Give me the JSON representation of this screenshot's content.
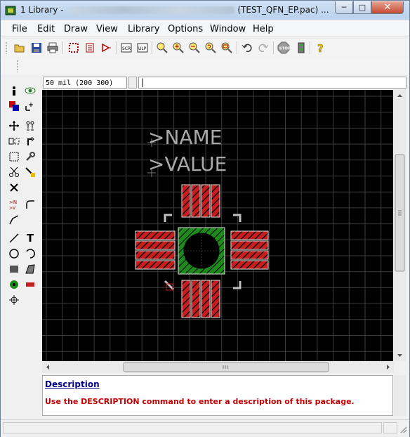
{
  "window": {
    "title_prefix": "1 Library - ",
    "title_suffix": "(TEST_QFN_EP.pac) ...",
    "controls": {
      "minimize": "─",
      "maximize": "□",
      "close": "✕"
    }
  },
  "menu": [
    "File",
    "Edit",
    "Draw",
    "View",
    "Library",
    "Options",
    "Window",
    "Help"
  ],
  "toolbar": {
    "icons": [
      "open-icon",
      "save-icon",
      "print-icon",
      "board-icon",
      "schematic-icon",
      "symbol-icon",
      "script-icon",
      "ulp-icon",
      "zoom-fit-icon",
      "zoom-in-icon",
      "zoom-out-icon",
      "zoom-redraw-icon",
      "zoom-select-icon",
      "undo-icon",
      "redo-icon",
      "stop-icon",
      "drc-icon",
      "help-icon"
    ]
  },
  "command_bar": {
    "grid_value": "50 mil (200 300)",
    "command_value": "|"
  },
  "left_toolbar": {
    "text_tool_label": "T"
  },
  "canvas": {
    "name_text": ">NAME",
    "value_text": ">VALUE",
    "grid_color": "#3c3c3c",
    "pad_color": "#c41e1e",
    "exposed_pad_color": "#1e8a1e"
  },
  "description": {
    "link": "Description",
    "message": "Use the DESCRIPTION command to enter a description of this package."
  }
}
